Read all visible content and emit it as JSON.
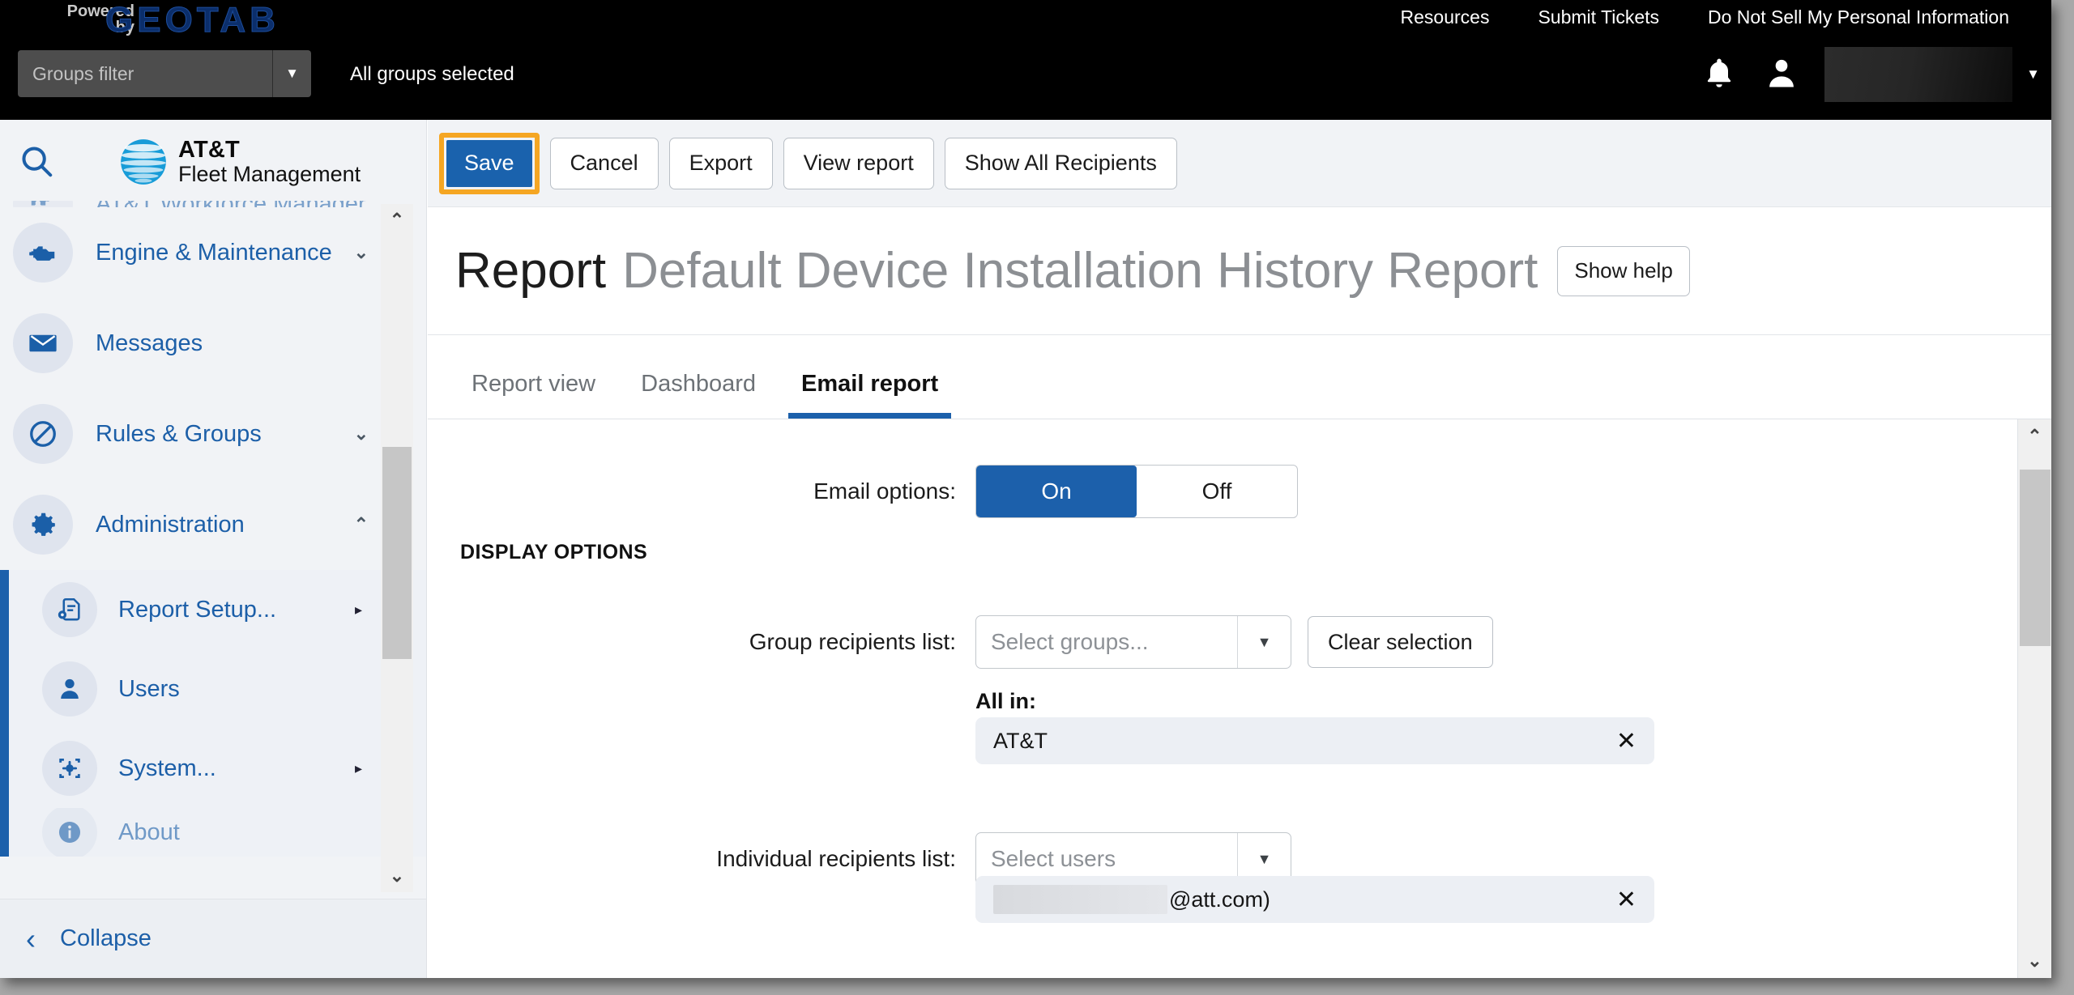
{
  "topbar": {
    "powered_line1": "Powered",
    "powered_line2": "by",
    "brand": "GEOTAB",
    "links": [
      {
        "label": "Resources"
      },
      {
        "label": "Submit Tickets"
      },
      {
        "label": "Do Not Sell My Personal Information"
      }
    ],
    "groups_filter_placeholder": "Groups filter",
    "groups_filter_value": "",
    "groups_status": "All groups selected",
    "user_name": ""
  },
  "sidebar": {
    "logo_line1": "AT&T",
    "logo_line2": "Fleet Management",
    "items": [
      {
        "label": "AT&T Workforce Manager",
        "icon": "puzzle-icon",
        "chevron": ""
      },
      {
        "label": "Engine & Maintenance",
        "icon": "engine-icon",
        "chevron": "⌄"
      },
      {
        "label": "Messages",
        "icon": "envelope-icon",
        "chevron": ""
      },
      {
        "label": "Rules & Groups",
        "icon": "no-entry-icon",
        "chevron": "⌄"
      },
      {
        "label": "Administration",
        "icon": "gear-icon",
        "chevron": "⌃"
      }
    ],
    "sub_items": [
      {
        "label": "Report Setup...",
        "icon": "report-setup-icon",
        "arrow": "▸"
      },
      {
        "label": "Users",
        "icon": "person-icon",
        "arrow": ""
      },
      {
        "label": "System...",
        "icon": "system-icon",
        "arrow": "▸"
      },
      {
        "label": "About",
        "icon": "info-icon",
        "arrow": ""
      }
    ],
    "collapse_label": "Collapse"
  },
  "toolbar": {
    "save_label": "Save",
    "cancel_label": "Cancel",
    "export_label": "Export",
    "view_report_label": "View report",
    "show_all_recipients_label": "Show All Recipients"
  },
  "page": {
    "title_prefix": "Report",
    "title_name": "Default Device Installation History Report",
    "help_label": "Show help"
  },
  "tabs": [
    {
      "label": "Report view",
      "active": false
    },
    {
      "label": "Dashboard",
      "active": false
    },
    {
      "label": "Email report",
      "active": true
    }
  ],
  "form": {
    "email_options_label": "Email options:",
    "email_on_label": "On",
    "email_off_label": "Off",
    "display_options_heading": "DISPLAY OPTIONS",
    "group_recipients_label": "Group recipients list:",
    "group_recipients_placeholder": "Select groups...",
    "clear_selection_label": "Clear selection",
    "all_in_label": "All in:",
    "all_in_chip": "AT&T",
    "individual_recipients_label": "Individual recipients list:",
    "individual_recipients_placeholder": "Select users",
    "individual_chip_suffix": "@att.com)",
    "remove_symbol": "✕"
  },
  "colors": {
    "accent_blue": "#1c60ab",
    "focus_orange": "#f5a623",
    "save_blue": "#1a62ad",
    "topbar_black": "#000000",
    "sidebar_bg": "#f1f3f6"
  }
}
